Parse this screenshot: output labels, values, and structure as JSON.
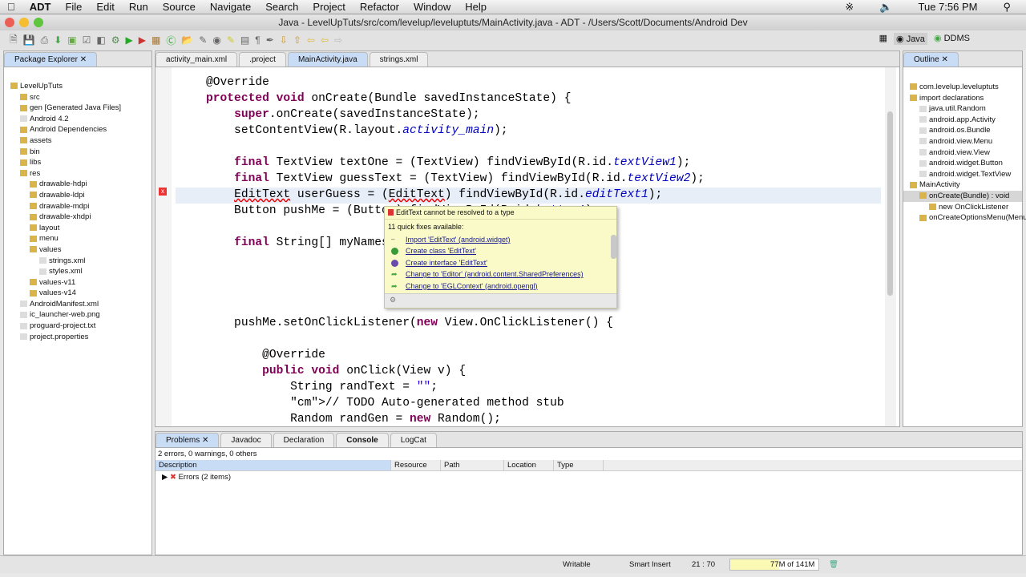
{
  "menubar": {
    "app": "ADT",
    "items": [
      "File",
      "Edit",
      "Run",
      "Source",
      "Navigate",
      "Search",
      "Project",
      "Refactor",
      "Window",
      "Help"
    ],
    "clock": "Tue 7:56 PM"
  },
  "window_title": "Java - LevelUpTuts/src/com/levelup/leveluptuts/MainActivity.java - ADT - /Users/Scott/Documents/Android Dev",
  "perspectives": [
    "Java",
    "DDMS"
  ],
  "package_explorer": {
    "title": "Package Explorer",
    "items": [
      {
        "label": "LevelUpTuts",
        "depth": 0
      },
      {
        "label": "src",
        "depth": 1
      },
      {
        "label": "gen [Generated Java Files]",
        "depth": 1
      },
      {
        "label": "Android 4.2",
        "depth": 1
      },
      {
        "label": "Android Dependencies",
        "depth": 1
      },
      {
        "label": "assets",
        "depth": 1
      },
      {
        "label": "bin",
        "depth": 1
      },
      {
        "label": "libs",
        "depth": 1
      },
      {
        "label": "res",
        "depth": 1
      },
      {
        "label": "drawable-hdpi",
        "depth": 2
      },
      {
        "label": "drawable-ldpi",
        "depth": 2
      },
      {
        "label": "drawable-mdpi",
        "depth": 2
      },
      {
        "label": "drawable-xhdpi",
        "depth": 2
      },
      {
        "label": "layout",
        "depth": 2
      },
      {
        "label": "menu",
        "depth": 2
      },
      {
        "label": "values",
        "depth": 2
      },
      {
        "label": "strings.xml",
        "depth": 3
      },
      {
        "label": "styles.xml",
        "depth": 3
      },
      {
        "label": "values-v11",
        "depth": 2
      },
      {
        "label": "values-v14",
        "depth": 2
      },
      {
        "label": "AndroidManifest.xml",
        "depth": 1
      },
      {
        "label": "ic_launcher-web.png",
        "depth": 1
      },
      {
        "label": "proguard-project.txt",
        "depth": 1
      },
      {
        "label": "project.properties",
        "depth": 1
      }
    ]
  },
  "editor_tabs": [
    "activity_main.xml",
    ".project",
    "MainActivity.java",
    "strings.xml"
  ],
  "code_lines": [
    "    @Override",
    "    protected void onCreate(Bundle savedInstanceState) {",
    "        super.onCreate(savedInstanceState);",
    "        setContentView(R.layout.activity_main);",
    "",
    "        final TextView textOne = (TextView) findViewById(R.id.textView1);",
    "        final TextView guessText = (TextView) findViewById(R.id.textView2);",
    "        EditText userGuess = (EditText) findViewById(R.id.editText1);",
    "        Button pushMe = (Button) findViewById(R.id.button1);",
    "",
    "        final String[] myNames = {\"Scott\", \"Jim\"};",
    "",
    "",
    "",
    "",
    "        pushMe.setOnClickListener(new View.OnClickListener() {",
    "",
    "            @Override",
    "            public void onClick(View v) {",
    "                String randText = \"\";",
    "                // TODO Auto-generated method stub",
    "                Random randGen = new Random();"
  ],
  "quickfix": {
    "title": "EditText cannot be resolved to a type",
    "count_label": "11 quick fixes available:",
    "items": [
      "Import 'EditText' (android.widget)",
      "Create class 'EditText'",
      "Create interface 'EditText'",
      "Change to 'Editor' (android.content.SharedPreferences)",
      "Change to 'EGLContext' (android.opengl)"
    ]
  },
  "outline": {
    "title": "Outline",
    "items": [
      {
        "label": "com.levelup.leveluptuts",
        "depth": 0
      },
      {
        "label": "import declarations",
        "depth": 0
      },
      {
        "label": "java.util.Random",
        "depth": 1
      },
      {
        "label": "android.app.Activity",
        "depth": 1
      },
      {
        "label": "android.os.Bundle",
        "depth": 1
      },
      {
        "label": "android.view.Menu",
        "depth": 1
      },
      {
        "label": "android.view.View",
        "depth": 1
      },
      {
        "label": "android.widget.Button",
        "depth": 1
      },
      {
        "label": "android.widget.TextView",
        "depth": 1
      },
      {
        "label": "MainActivity",
        "depth": 0
      },
      {
        "label": "onCreate(Bundle) : void",
        "depth": 1
      },
      {
        "label": "new OnClickListener",
        "depth": 2
      },
      {
        "label": "onCreateOptionsMenu(Menu)",
        "depth": 1
      }
    ]
  },
  "bottom": {
    "tabs": [
      "Problems",
      "Javadoc",
      "Declaration",
      "Console",
      "LogCat"
    ],
    "summary": "2 errors, 0 warnings, 0 others",
    "columns": [
      "Description",
      "Resource",
      "Path",
      "Location",
      "Type"
    ],
    "rows": [
      "Errors (2 items)"
    ]
  },
  "status": {
    "writable": "Writable",
    "insert": "Smart Insert",
    "position": "21 : 70",
    "heap": "77M of 141M",
    "heap_used_fraction": 0.55
  }
}
